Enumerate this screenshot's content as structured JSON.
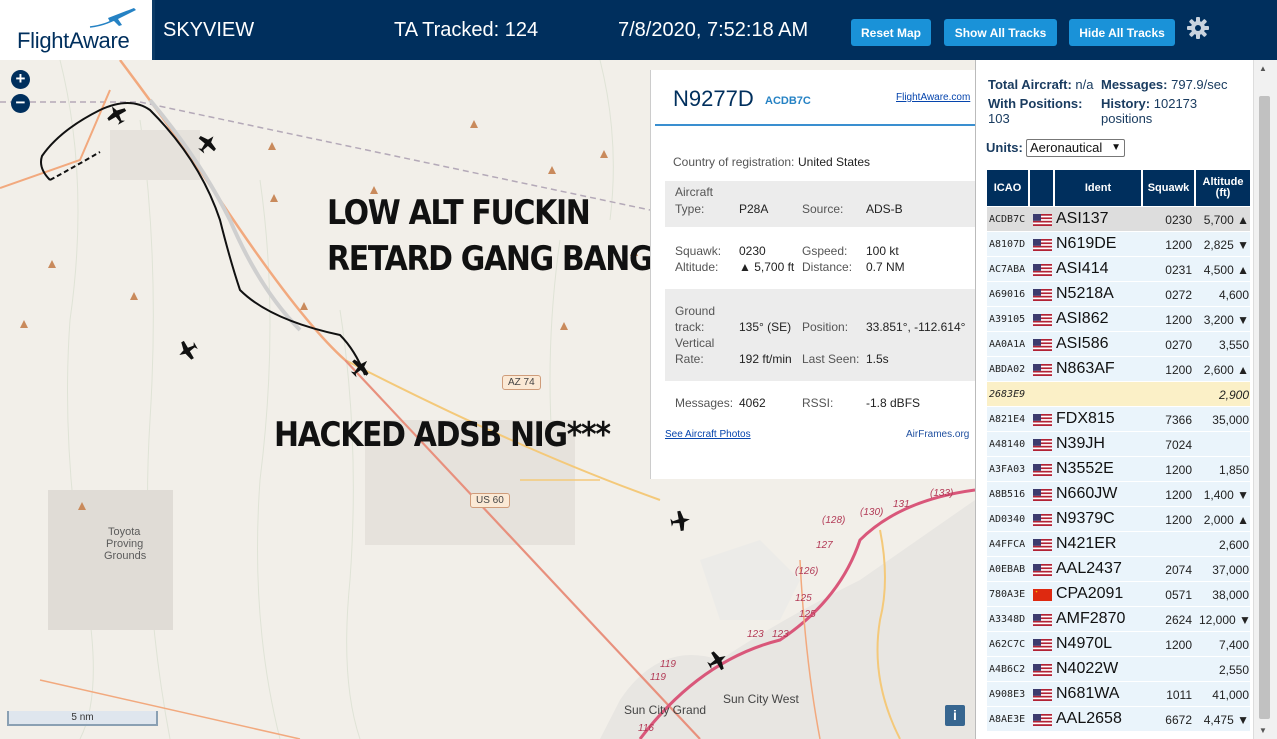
{
  "header": {
    "logo_text": "FlightAware",
    "app_title": "SKYVIEW",
    "tracked": "TA Tracked: 124",
    "datetime": "7/8/2020, 7:52:18 AM",
    "btn_reset": "Reset Map",
    "btn_show": "Show All Tracks",
    "btn_hide": "Hide All Tracks"
  },
  "map": {
    "zoom_in": "+",
    "zoom_out": "−",
    "overlay_1a": "LOW ALT FUCKIN",
    "overlay_1b": "RETARD GANG BANGER",
    "overlay_2": "HACKED ADSB NIG***",
    "label_toyota_1": "Toyota",
    "label_toyota_2": "Proving",
    "label_toyota_3": "Grounds",
    "label_suncitygrand": "Sun City Grand",
    "label_suncitywest": "Sun City West",
    "shield_az74": "AZ 74",
    "shield_us60": "US 60",
    "hwy_128": "(128)",
    "hwy_130": "(130)",
    "hwy_131": "131",
    "hwy_133": "(133)",
    "hwy_127": "127",
    "hwy_126": "(126)",
    "hwy_125a": "125",
    "hwy_125b": "125",
    "hwy_123a": "123",
    "hwy_123b": "123",
    "hwy_119a": "119",
    "hwy_119b": "119",
    "hwy_116": "116",
    "scale": "5 nm",
    "info": "i"
  },
  "popup": {
    "registration": "N9277D",
    "hex": "ACDB7C",
    "fa_link": "FlightAware.com",
    "country_label": "Country of registration:",
    "country": "United States",
    "type_label_a": "Aircraft",
    "type_label_b": "Type:",
    "type": "P28A",
    "source_label": "Source:",
    "source": "ADS-B",
    "squawk_label": "Squawk:",
    "altitude_label": "Altitude:",
    "squawk": "0230",
    "altitude": "▲ 5,700 ft",
    "gspeed_label": "Gspeed:",
    "gspeed": "100 kt",
    "distance_label": "Distance:",
    "distance": "0.7 NM",
    "track_label_a": "Ground",
    "track_label_b": "track:",
    "track": "135° (SE)",
    "position_label": "Position:",
    "position": "33.851°, -112.614°",
    "vrate_label_a": "Vertical",
    "vrate_label_b": "Rate:",
    "vrate": "192 ft/min",
    "lastseen_label": "Last Seen:",
    "lastseen": "1.5s",
    "messages_label": "Messages:",
    "messages": "4062",
    "rssi_label": "RSSI:",
    "rssi": "-1.8 dBFS",
    "photos_link": "See Aircraft Photos",
    "airframes_link": "AirFrames.org"
  },
  "sidebar": {
    "total_label": "Total Aircraft:",
    "total": "n/a",
    "messages_label": "Messages:",
    "messages": "797.9/sec",
    "withpos_label": "With Positions:",
    "withpos": "103",
    "history_label": "History:",
    "history_a": "102173",
    "history_b": "positions",
    "units_label": "Units:",
    "units_value": "Aeronautical",
    "columns": [
      "ICAO",
      "",
      "Ident",
      "Squawk",
      "Altitude (ft)"
    ],
    "rows": [
      {
        "icao": "ACDB7C",
        "flag": "us",
        "ident": "ASI137",
        "squawk": "0230",
        "alt": "5,700 ▲",
        "style": "sel"
      },
      {
        "icao": "A8107D",
        "flag": "us",
        "ident": "N619DE",
        "squawk": "1200",
        "alt": "2,825 ▼",
        "style": ""
      },
      {
        "icao": "AC7ABA",
        "flag": "us",
        "ident": "ASI414",
        "squawk": "0231",
        "alt": "4,500 ▲",
        "style": ""
      },
      {
        "icao": "A69016",
        "flag": "us",
        "ident": "N5218A",
        "squawk": "0272",
        "alt": "4,600",
        "style": ""
      },
      {
        "icao": "A39105",
        "flag": "us",
        "ident": "ASI862",
        "squawk": "1200",
        "alt": "3,200 ▼",
        "style": ""
      },
      {
        "icao": "AA0A1A",
        "flag": "us",
        "ident": "ASI586",
        "squawk": "0270",
        "alt": "3,550",
        "style": ""
      },
      {
        "icao": "ABDA02",
        "flag": "us",
        "ident": "N863AF",
        "squawk": "1200",
        "alt": "2,600 ▲",
        "style": ""
      },
      {
        "icao": "2683E9",
        "flag": "",
        "ident": "",
        "squawk": "",
        "alt": "2,900",
        "style": "yel"
      },
      {
        "icao": "A821E4",
        "flag": "us",
        "ident": "FDX815",
        "squawk": "7366",
        "alt": "35,000",
        "style": ""
      },
      {
        "icao": "A48140",
        "flag": "us",
        "ident": "N39JH",
        "squawk": "7024",
        "alt": "",
        "style": ""
      },
      {
        "icao": "A3FA03",
        "flag": "us",
        "ident": "N3552E",
        "squawk": "1200",
        "alt": "1,850",
        "style": ""
      },
      {
        "icao": "A8B516",
        "flag": "us",
        "ident": "N660JW",
        "squawk": "1200",
        "alt": "1,400 ▼",
        "style": ""
      },
      {
        "icao": "AD0340",
        "flag": "us",
        "ident": "N9379C",
        "squawk": "1200",
        "alt": "2,000 ▲",
        "style": ""
      },
      {
        "icao": "A4FFCA",
        "flag": "us",
        "ident": "N421ER",
        "squawk": "",
        "alt": "2,600",
        "style": ""
      },
      {
        "icao": "A0EBAB",
        "flag": "us",
        "ident": "AAL2437",
        "squawk": "2074",
        "alt": "37,000",
        "style": ""
      },
      {
        "icao": "780A3E",
        "flag": "cn",
        "ident": "CPA2091",
        "squawk": "0571",
        "alt": "38,000",
        "style": ""
      },
      {
        "icao": "A3348D",
        "flag": "us",
        "ident": "AMF2870",
        "squawk": "2624",
        "alt": "12,000 ▼",
        "style": ""
      },
      {
        "icao": "A62C7C",
        "flag": "us",
        "ident": "N4970L",
        "squawk": "1200",
        "alt": "7,400",
        "style": ""
      },
      {
        "icao": "A4B6C2",
        "flag": "us",
        "ident": "N4022W",
        "squawk": "",
        "alt": "2,550",
        "style": ""
      },
      {
        "icao": "A908E3",
        "flag": "us",
        "ident": "N681WA",
        "squawk": "1011",
        "alt": "41,000",
        "style": ""
      },
      {
        "icao": "A8AE3E",
        "flag": "us",
        "ident": "AAL2658",
        "squawk": "6672",
        "alt": "4,475 ▼",
        "style": ""
      }
    ]
  },
  "colors": {
    "header_bg": "#002f5d",
    "button_bg": "#1a92d8",
    "table_header_bg": "#002f5d",
    "row_bg": "#eaf4fb",
    "selected_row_bg": "#dddddd",
    "no_position_row_bg": "#fbf0c7",
    "map_bg": "#f2efe9",
    "track_line": "#111111"
  }
}
